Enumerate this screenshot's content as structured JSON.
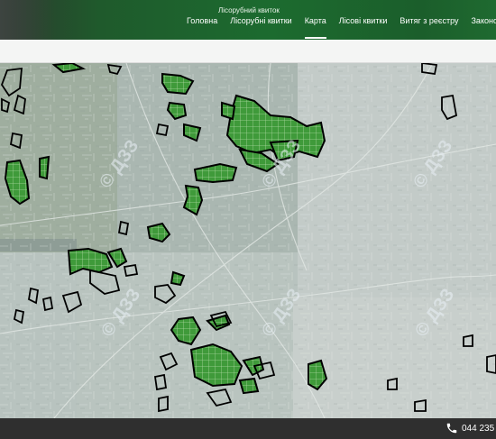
{
  "header": {
    "site_title": "Лісорубний квиток",
    "nav": [
      {
        "label": "Головна",
        "active": false
      },
      {
        "label": "Лісорубні квитки",
        "active": false
      },
      {
        "label": "Карта",
        "active": true
      },
      {
        "label": "Лісові квитки",
        "active": false
      },
      {
        "label": "Витяг з реєстру",
        "active": false
      },
      {
        "label": "Законодавчі",
        "active": false
      }
    ]
  },
  "map": {
    "watermark": "© ДЗЗ",
    "parcel_color": "#3f9a3a",
    "outline_color": "#000000"
  },
  "footer": {
    "phone": "044 235",
    "phone_icon": "phone-icon"
  }
}
